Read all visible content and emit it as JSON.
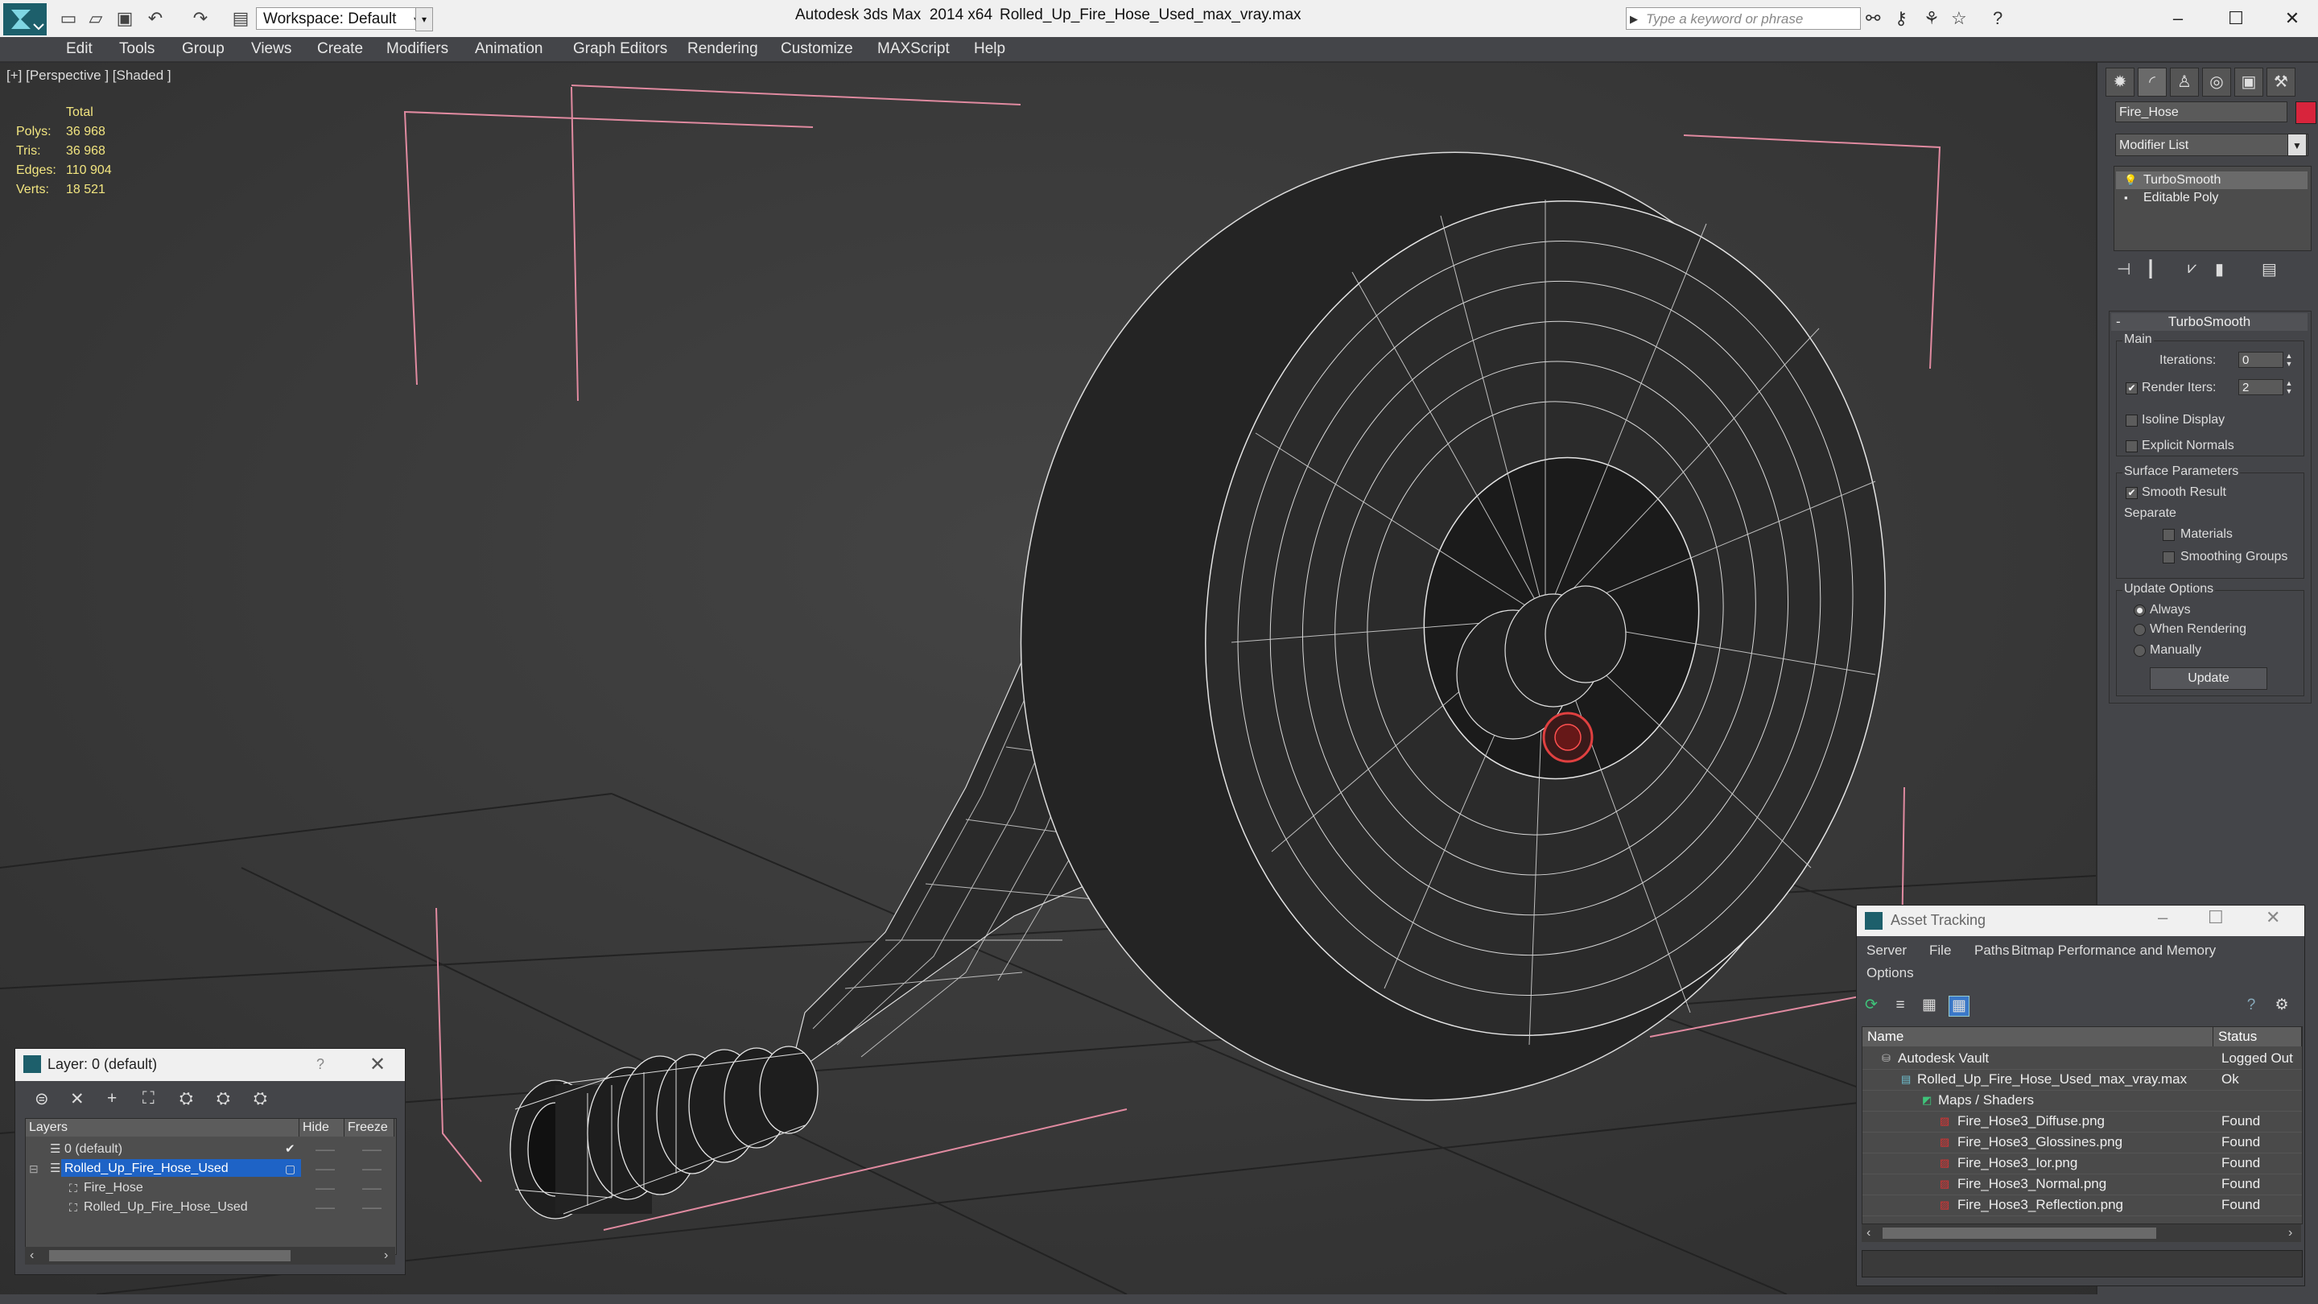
{
  "window": {
    "app_title": "Autodesk 3ds Max  2014 x64",
    "file_name": "Rolled_Up_Fire_Hose_Used_max_vray.max",
    "workspace": "Workspace: Default",
    "search_placeholder": "Type a keyword or phrase"
  },
  "menu": [
    "Edit",
    "Tools",
    "Group",
    "Views",
    "Create",
    "Modifiers",
    "Animation",
    "Graph Editors",
    "Rendering",
    "Customize",
    "MAXScript",
    "Help"
  ],
  "viewport": {
    "label": "[+] [Perspective ] [Shaded ]",
    "stats": {
      "total_label": "Total",
      "rows": [
        {
          "k": "Polys:",
          "v": "36 968"
        },
        {
          "k": "Tris:",
          "v": "36 968"
        },
        {
          "k": "Edges:",
          "v": "110 904"
        },
        {
          "k": "Verts:",
          "v": "18 521"
        }
      ]
    }
  },
  "command_panel": {
    "object_name": "Fire_Hose",
    "object_color": "#d8243c",
    "modifier_list": "Modifier List",
    "stack": [
      "TurboSmooth",
      "Editable Poly"
    ],
    "rollout_title": "TurboSmooth",
    "main_label": "Main",
    "iterations_label": "Iterations:",
    "iterations_value": "0",
    "render_iters_label": "Render Iters:",
    "render_iters_value": "2",
    "render_iters_checked": true,
    "isoline_label": "Isoline Display",
    "explicit_normals_label": "Explicit Normals",
    "surface_params_label": "Surface Parameters",
    "smooth_result_label": "Smooth Result",
    "separate_label": "Separate",
    "materials_label": "Materials",
    "smoothing_groups_label": "Smoothing Groups",
    "update_options_label": "Update Options",
    "always_label": "Always",
    "when_rendering_label": "When Rendering",
    "manually_label": "Manually",
    "update_button": "Update"
  },
  "layer_dialog": {
    "title": "Layer: 0 (default)",
    "help": "?",
    "columns": {
      "layers": "Layers",
      "hide": "Hide",
      "freeze": "Freeze"
    },
    "rows": [
      {
        "name": "0 (default)",
        "indent": 1,
        "selected": false
      },
      {
        "name": "Rolled_Up_Fire_Hose_Used",
        "indent": 1,
        "selected": true
      },
      {
        "name": "Fire_Hose",
        "indent": 2,
        "selected": false
      },
      {
        "name": "Rolled_Up_Fire_Hose_Used",
        "indent": 2,
        "selected": false
      }
    ]
  },
  "asset_tracking": {
    "title": "Asset Tracking",
    "menu": [
      "Server",
      "File",
      "Paths",
      "Bitmap Performance and Memory"
    ],
    "menu2": "Options",
    "columns": {
      "name": "Name",
      "status": "Status"
    },
    "rows": [
      {
        "name": "Autodesk Vault",
        "status": "Logged Out",
        "indent": 0
      },
      {
        "name": "Rolled_Up_Fire_Hose_Used_max_vray.max",
        "status": "Ok",
        "indent": 1
      },
      {
        "name": "Maps / Shaders",
        "status": "",
        "indent": 2
      },
      {
        "name": "Fire_Hose3_Diffuse.png",
        "status": "Found",
        "indent": 3
      },
      {
        "name": "Fire_Hose3_Glossines.png",
        "status": "Found",
        "indent": 3
      },
      {
        "name": "Fire_Hose3_Ior.png",
        "status": "Found",
        "indent": 3
      },
      {
        "name": "Fire_Hose3_Normal.png",
        "status": "Found",
        "indent": 3
      },
      {
        "name": "Fire_Hose3_Reflection.png",
        "status": "Found",
        "indent": 3
      }
    ]
  }
}
